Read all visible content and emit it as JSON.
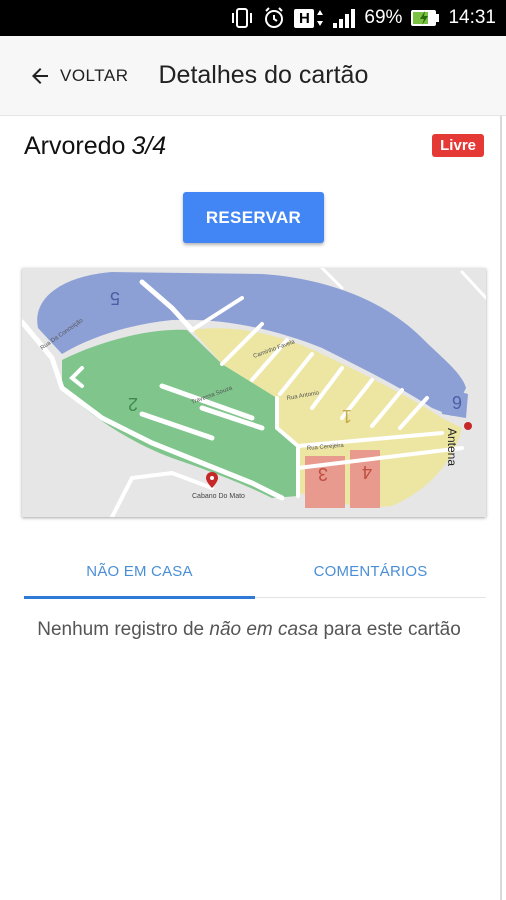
{
  "status_bar": {
    "battery": "69%",
    "time": "14:31",
    "network_badge": "H",
    "icons": [
      "vibrate-icon",
      "alarm-icon",
      "network-h-icon",
      "signal-icon",
      "battery-charging-icon"
    ]
  },
  "app_bar": {
    "back_label": "VOLTAR",
    "title": "Detalhes do cartão"
  },
  "card": {
    "name": "Arvoredo",
    "number": "3/4",
    "status_badge": "Livre",
    "reserve_label": "RESERVAR"
  },
  "map": {
    "zones": [
      "5",
      "2",
      "1",
      "3",
      "4",
      "6"
    ],
    "place_label": "Cabano Do Mato",
    "landmark_label": "Antena",
    "street_labels": [
      "Rua Da Conceição",
      "Caminho Favela",
      "Rua Antonio",
      "Travessa Souza",
      "Rua Cerejeira"
    ]
  },
  "tabs": {
    "not_home": "NÃO EM CASA",
    "comments": "COMENTÁRIOS",
    "active": "not_home"
  },
  "empty_state": {
    "prefix": "Nenhum registro de",
    "emphasis": "não em casa",
    "suffix": "para este cartão"
  },
  "colors": {
    "primary": "#4285f4",
    "badge_red": "#e53935",
    "tab_text": "#4a8fd6",
    "zone_blue": "#8da0d6",
    "zone_green": "#7fc58c",
    "zone_yellow": "#ede6a3",
    "zone_red": "#e89a8f"
  }
}
